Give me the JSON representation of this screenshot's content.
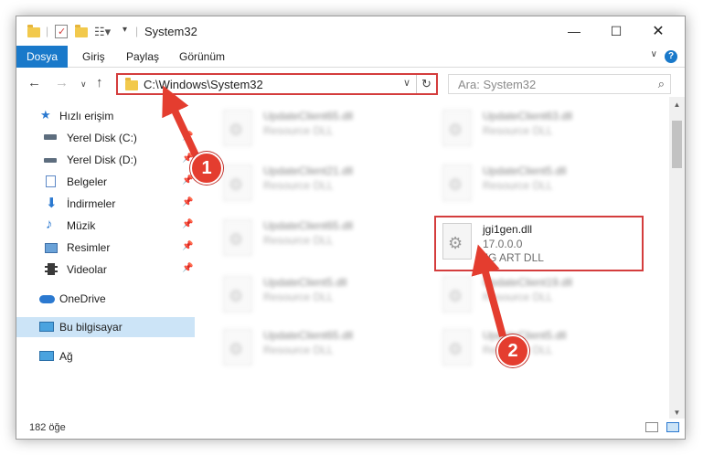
{
  "window": {
    "title": "System32"
  },
  "ribbon": {
    "tabs": [
      "Dosya",
      "Giriş",
      "Paylaş",
      "Görünüm"
    ]
  },
  "address": {
    "path": "C:\\Windows\\System32",
    "search_placeholder": "Ara: System32"
  },
  "sidebar": {
    "items": [
      {
        "label": "Hızlı erişim",
        "icon": "star-icon",
        "pinned": false
      },
      {
        "label": "Yerel Disk (C:)",
        "icon": "drive-icon",
        "pinned": true
      },
      {
        "label": "Yerel Disk (D:)",
        "icon": "drive-icon",
        "pinned": true
      },
      {
        "label": "Belgeler",
        "icon": "documents-icon",
        "pinned": true
      },
      {
        "label": "İndirmeler",
        "icon": "download-icon",
        "pinned": true
      },
      {
        "label": "Müzik",
        "icon": "music-icon",
        "pinned": true
      },
      {
        "label": "Resimler",
        "icon": "pictures-icon",
        "pinned": true
      },
      {
        "label": "Videolar",
        "icon": "videos-icon",
        "pinned": true
      },
      {
        "label": "OneDrive",
        "icon": "cloud-icon",
        "pinned": false
      },
      {
        "label": "Bu bilgisayar",
        "icon": "computer-icon",
        "pinned": false,
        "selected": true
      },
      {
        "label": "Ağ",
        "icon": "network-icon",
        "pinned": false
      }
    ]
  },
  "files": [
    {
      "name": "UpdateClient65.dll",
      "type": "Resource DLL"
    },
    {
      "name": "UpdateClient63.dll",
      "type": "Resource DLL"
    },
    {
      "name": "UpdateClient21.dll",
      "type": "Resource DLL"
    },
    {
      "name": "UpdateClient5.dll",
      "type": "Resource DLL"
    },
    {
      "name": "UpdateClient65.dll",
      "type": "Resource DLL"
    },
    {
      "name": "UpdateClient5.dll",
      "type": "Resource DLL"
    },
    {
      "name": "UpdateClient19.dll",
      "type": "Resource DLL"
    },
    {
      "name": "UpdateClient65.dll",
      "type": "Resource DLL"
    },
    {
      "name": "UpdateClient5.dll",
      "type": "Resource DLL"
    }
  ],
  "highlighted_file": {
    "name": "jgi1gen.dll",
    "version": "17.0.0.0",
    "description": "JG ART DLL"
  },
  "status": {
    "item_count": "182 öğe"
  },
  "annotations": {
    "callout1": "1",
    "callout2": "2",
    "color": "#e43d2f"
  }
}
